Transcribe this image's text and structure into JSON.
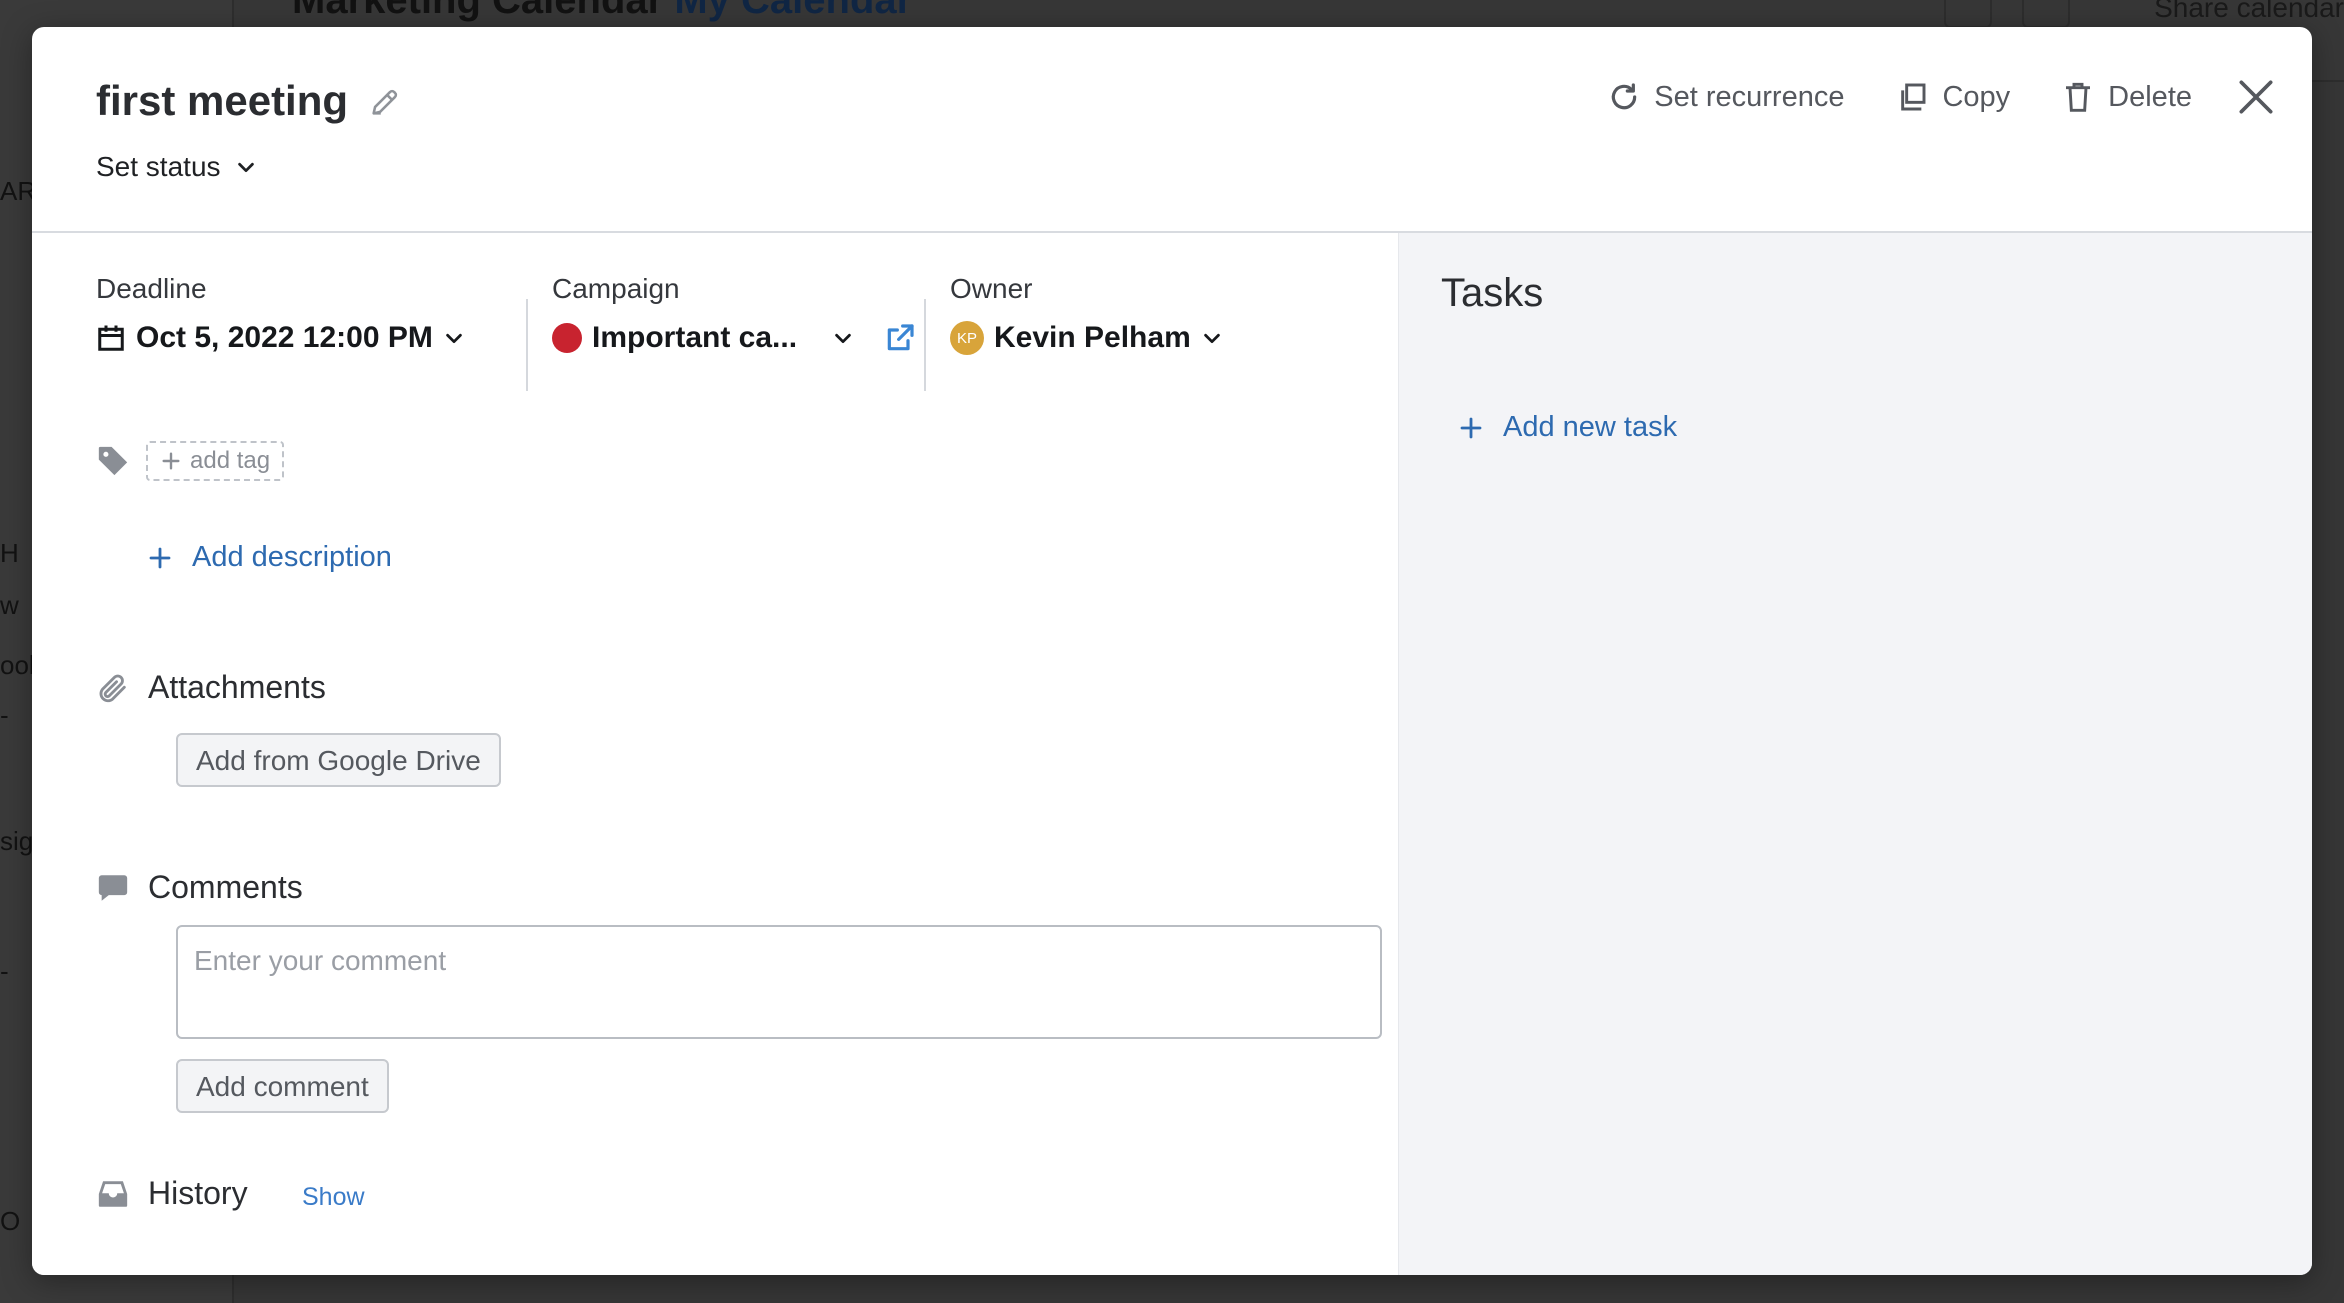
{
  "background": {
    "title": "Marketing Calendar",
    "calendar_selector": "My Calendar",
    "share_label": "Share calendar",
    "sidebar_fragments": [
      "ARC",
      "H",
      "w",
      "ool",
      "-",
      "sig",
      "-",
      "O"
    ]
  },
  "modal": {
    "title": "first meeting",
    "status_label": "Set status",
    "actions": {
      "recurrence": "Set recurrence",
      "copy": "Copy",
      "delete": "Delete"
    },
    "deadline": {
      "label": "Deadline",
      "value": "Oct 5, 2022 12:00 PM"
    },
    "campaign": {
      "label": "Campaign",
      "value": "Important ca...",
      "color": "#c8232f"
    },
    "owner": {
      "label": "Owner",
      "initials": "KP",
      "name": "Kevin Pelham",
      "avatar_color": "#d8a43a"
    },
    "tag": {
      "add_label": "add tag"
    },
    "description": {
      "add_label": "Add description"
    },
    "attachments": {
      "title": "Attachments",
      "google_drive_button": "Add from Google Drive"
    },
    "comments": {
      "title": "Comments",
      "placeholder": "Enter your comment",
      "value": "",
      "submit_label": "Add comment"
    },
    "history": {
      "title": "History",
      "toggle_label": "Show"
    },
    "tasks": {
      "title": "Tasks",
      "add_label": "Add new task"
    }
  },
  "colors": {
    "accent_blue": "#2d6ab0",
    "link_blue": "#3a7bc8",
    "panel_gray": "#f3f4f7"
  }
}
